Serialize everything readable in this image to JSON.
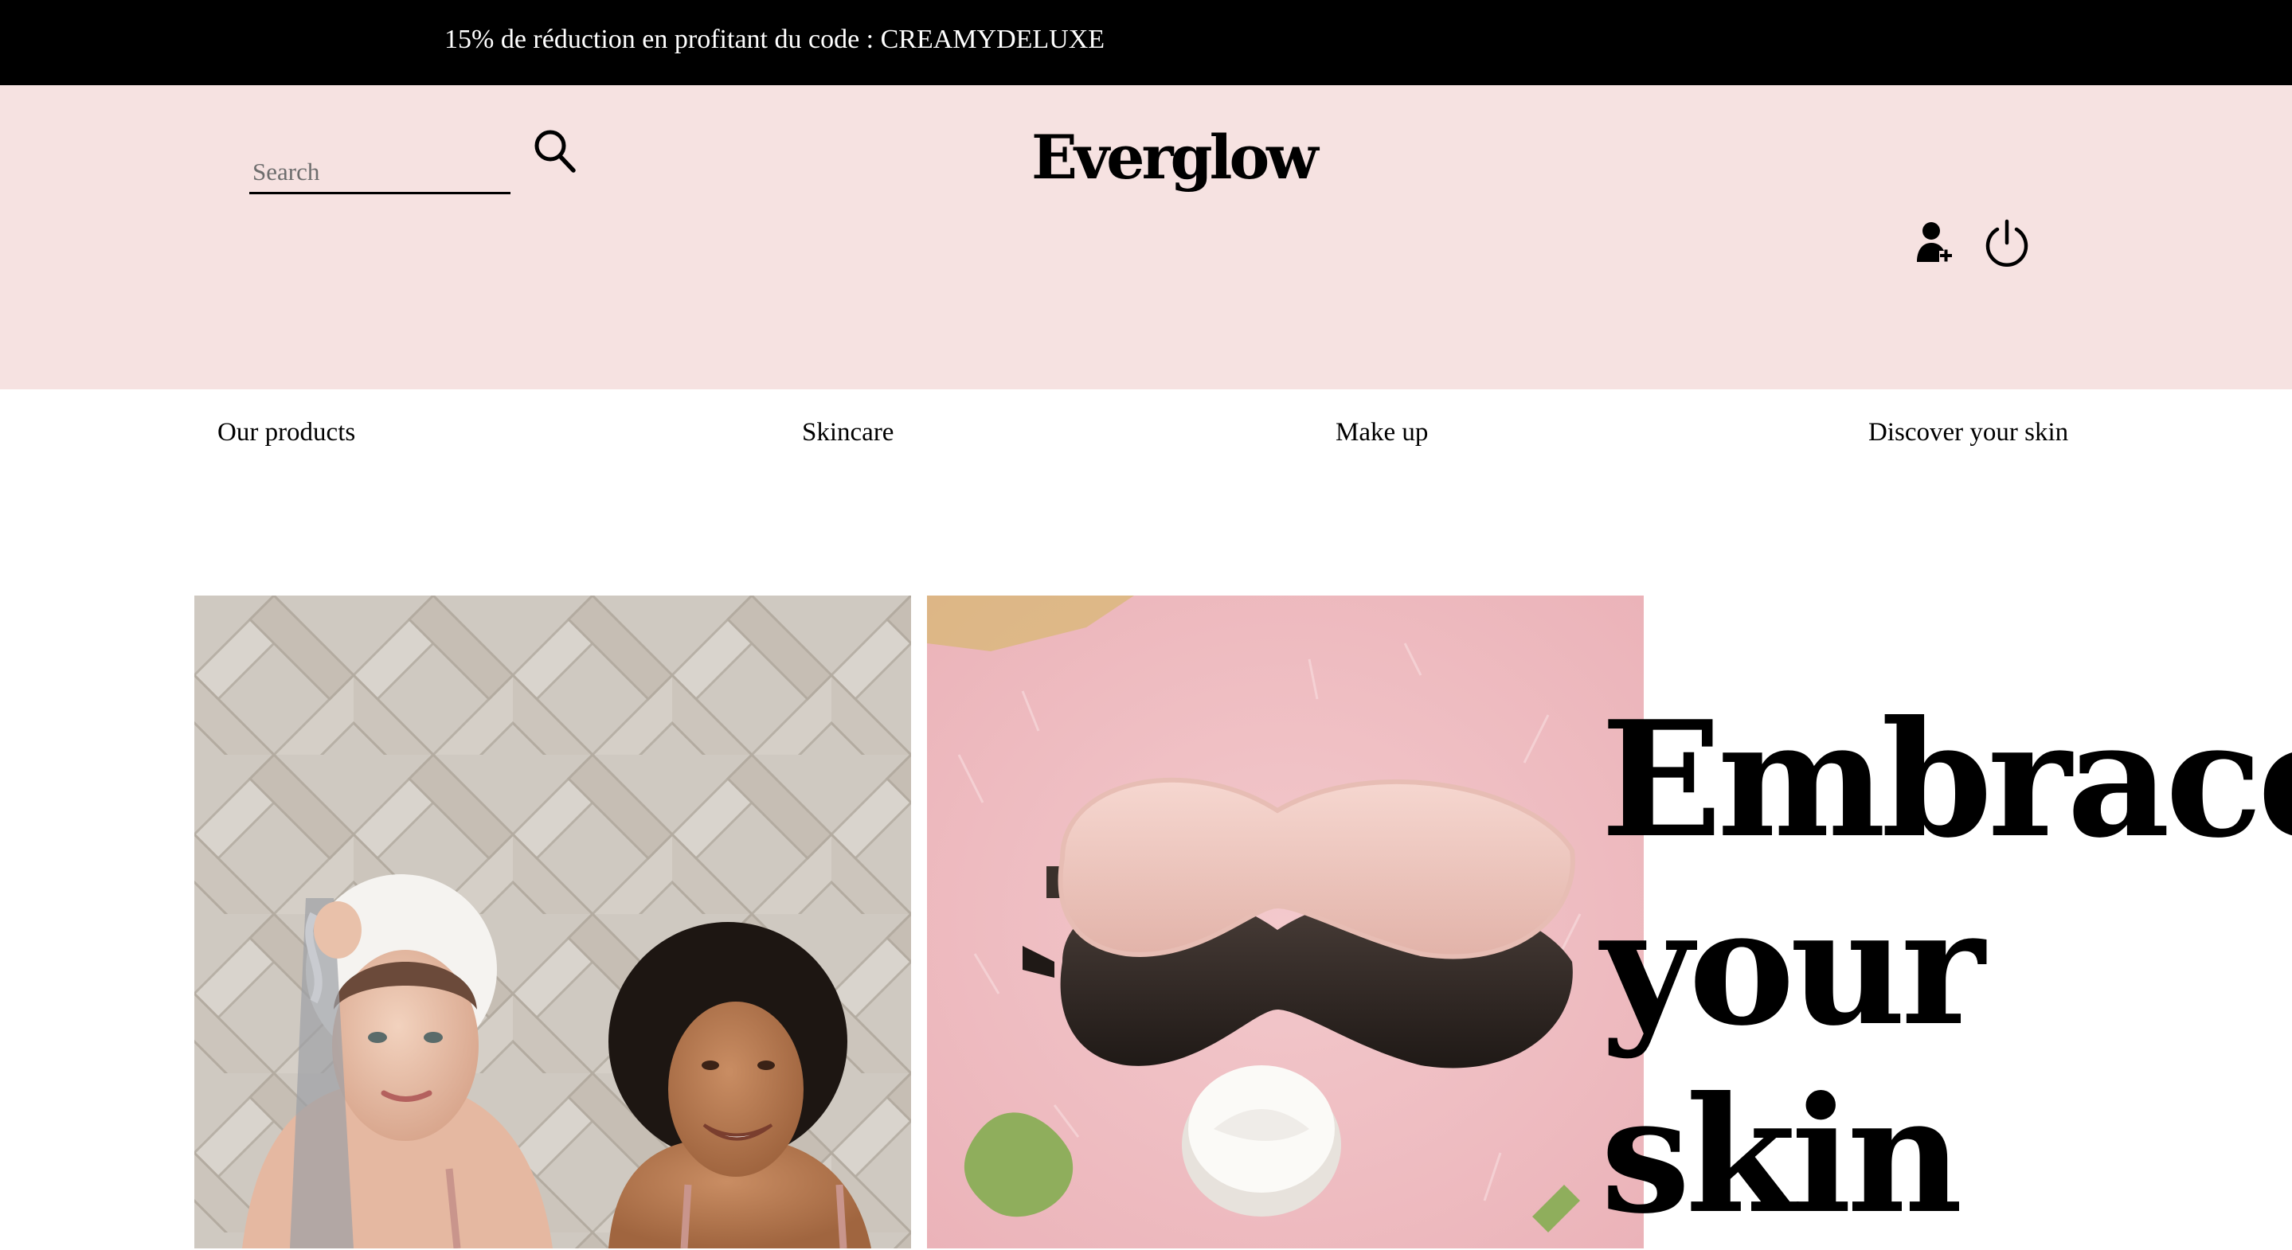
{
  "promo": {
    "text": "15% de réduction en profitant du code : CREAMYDELUXE"
  },
  "header": {
    "search_placeholder": "Search",
    "logo": "Everglow",
    "background": "#f6e2e1"
  },
  "nav": {
    "items": [
      {
        "label": "Our products"
      },
      {
        "label": "Skincare"
      },
      {
        "label": "Make up"
      },
      {
        "label": "Discover your skin"
      }
    ]
  },
  "hero": {
    "title_lines": [
      "Embrace",
      "your",
      "skin"
    ]
  },
  "icons": {
    "search": "search-icon",
    "account": "user-add-icon",
    "logout": "power-icon"
  }
}
